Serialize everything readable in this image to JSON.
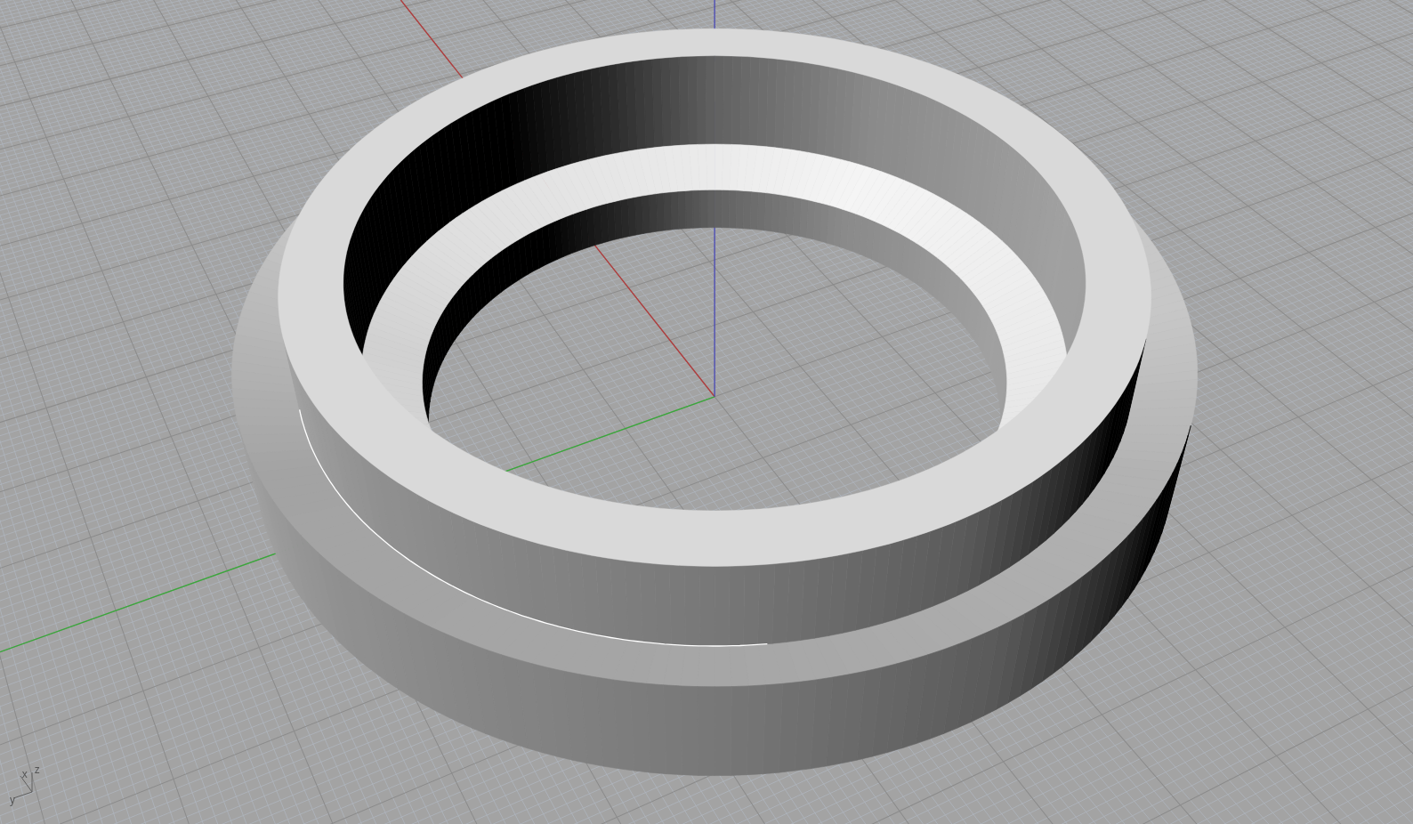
{
  "viewport": {
    "axis_gizmo": {
      "labels": [
        {
          "kind": "x",
          "text": "x"
        },
        {
          "kind": "z",
          "text": "z"
        },
        {
          "kind": "y",
          "text": "y"
        }
      ]
    }
  }
}
